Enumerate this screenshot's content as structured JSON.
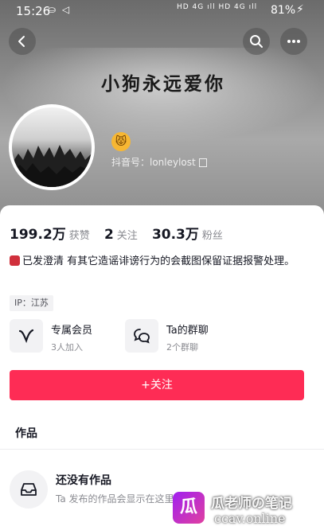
{
  "status_bar": {
    "time": "15:26",
    "icons_left": "⛀ ◁",
    "signal_text": "HD 4G ıll HD 4G ıll",
    "battery": "81%"
  },
  "profile": {
    "nickname_art": "小狗永远爱你",
    "douyin_id": "抖音号：lonleylost",
    "emoji": "😾"
  },
  "stats": {
    "likes_num": "199.2万",
    "likes_label": "获赞",
    "following_num": "2",
    "following_label": "关注",
    "followers_num": "30.3万",
    "followers_label": "粉丝"
  },
  "bio": {
    "text": "已发澄清  有其它造谣诽谤行为的会截图保留证据报警处理。"
  },
  "ip": {
    "label": "IP：江苏"
  },
  "entries": [
    {
      "title": "专属会员",
      "subtitle": "3人加入",
      "icon": "v-membership-icon"
    },
    {
      "title": "Ta的群聊",
      "subtitle": "2个群聊",
      "icon": "chat-bubbles-icon"
    }
  ],
  "follow_button": {
    "label": "+关注"
  },
  "tabs": {
    "works": "作品"
  },
  "empty_state": {
    "title": "还没有作品",
    "subtitle": "Ta 发布的作品会显示在这里"
  },
  "watermark": {
    "logo_char": "瓜",
    "line1": "瓜老师の笔记",
    "line2": "ccav.online"
  },
  "colors": {
    "accent": "#fe2c55",
    "text": "#161823",
    "muted": "#8a8b91"
  }
}
